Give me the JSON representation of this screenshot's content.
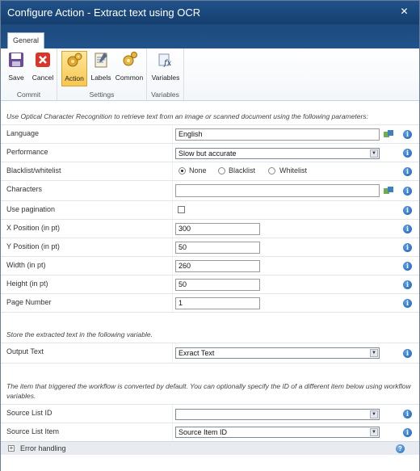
{
  "window": {
    "title": "Configure Action - Extract text using OCR",
    "close_glyph": "✕"
  },
  "tabs": [
    {
      "label": "General"
    }
  ],
  "ribbon": {
    "groups": [
      {
        "label": "Commit",
        "buttons": [
          {
            "label": "Save",
            "icon": "save-icon"
          },
          {
            "label": "Cancel",
            "icon": "cancel-icon"
          }
        ]
      },
      {
        "label": "Settings",
        "buttons": [
          {
            "label": "Action",
            "icon": "action-gears-icon"
          },
          {
            "label": "Labels",
            "icon": "labels-notepad-icon"
          },
          {
            "label": "Common",
            "icon": "common-gears-icon"
          }
        ]
      },
      {
        "label": "Variables",
        "buttons": [
          {
            "label": "Variables",
            "icon": "variables-fx-icon"
          }
        ]
      }
    ]
  },
  "form": {
    "intro": "Use Optical Character Recognition to retrieve text from an image or scanned document using the following parameters:",
    "language": {
      "label": "Language",
      "value": "English"
    },
    "performance": {
      "label": "Performance",
      "value": "Slow but accurate"
    },
    "blacklist": {
      "label": "Blacklist/whitelist",
      "options": [
        "None",
        "Blacklist",
        "Whitelist"
      ],
      "selected": "None"
    },
    "characters": {
      "label": "Characters",
      "value": ""
    },
    "pagination": {
      "label": "Use pagination",
      "checked": false
    },
    "x_position": {
      "label": "X Position (in pt)",
      "value": "300"
    },
    "y_position": {
      "label": "Y Position (in pt)",
      "value": "50"
    },
    "width": {
      "label": "Width (in pt)",
      "value": "260"
    },
    "height": {
      "label": "Height (in pt)",
      "value": "50"
    },
    "page_number": {
      "label": "Page Number",
      "value": "1"
    },
    "store_intro": "Store the extracted text in the following variable.",
    "output_text": {
      "label": "Output Text",
      "value": "Exract Text"
    },
    "item_intro": "The item that triggered the workflow is converted by default. You can optionally specify the ID of a different item below using workflow variables.",
    "source_list_id": {
      "label": "Source List ID",
      "value": ""
    },
    "source_list_item": {
      "label": "Source List Item",
      "value": "Source Item ID"
    },
    "error_handling": {
      "label": "Error handling"
    }
  },
  "icons": {
    "info": "i",
    "help": "?",
    "expand": "+",
    "dropdown": "▼"
  },
  "colors": {
    "title_bar": "#21528a",
    "active_button": "#f9c64f",
    "info_icon": "#1f5fb0"
  }
}
